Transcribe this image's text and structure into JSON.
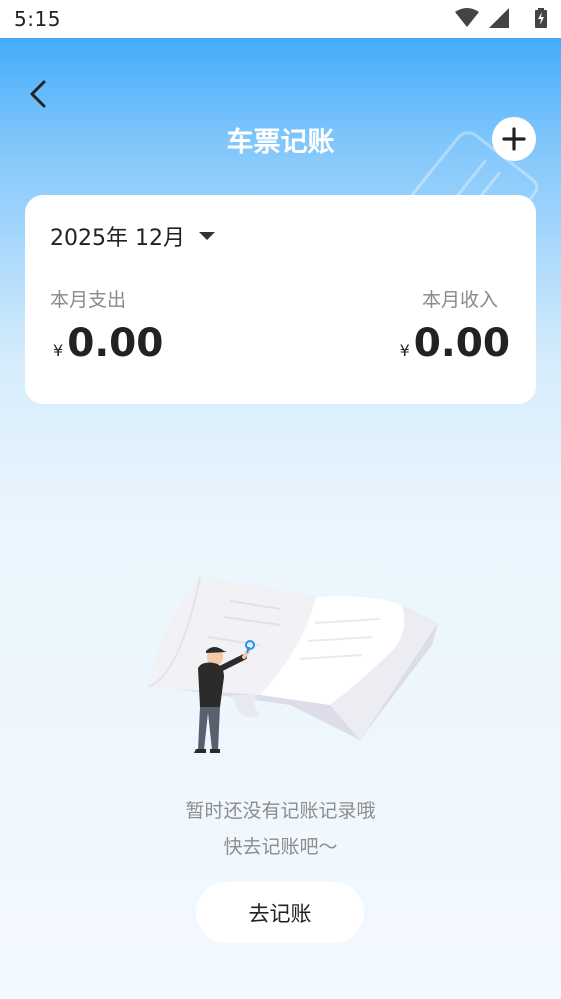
{
  "status_bar": {
    "time": "5:15"
  },
  "header": {
    "title": "车票记账"
  },
  "summary": {
    "month": "2025年 12月",
    "expense_label": "本月支出",
    "income_label": "本月收入",
    "currency": "¥",
    "expense_value": "0.00",
    "income_value": "0.00"
  },
  "empty_state": {
    "line1": "暂时还没有记账记录哦",
    "line2": "快去记账吧～",
    "button_label": "去记账"
  },
  "colors": {
    "header_blue": "#2ea2fb",
    "text_dark": "#222222",
    "text_grey": "#8a8a8a"
  }
}
